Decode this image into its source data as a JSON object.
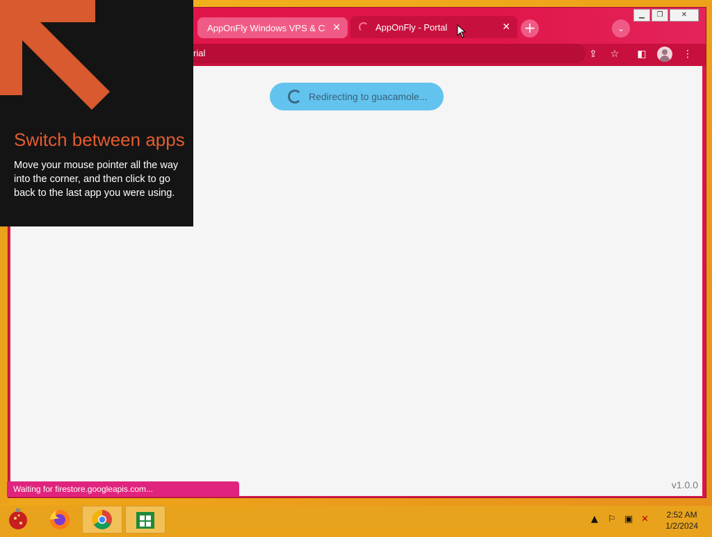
{
  "browser": {
    "tabs": [
      {
        "label": "AppOnFly Windows VPS & Cloud"
      },
      {
        "label": "AppOnFly - Portal"
      }
    ],
    "address_text": "rial"
  },
  "page": {
    "redirect_text": "Redirecting to guacamole...",
    "version": "v1.0.0",
    "status_text": "Waiting for firestore.googleapis.com..."
  },
  "tip": {
    "title": "Switch between apps",
    "body": "Move your mouse pointer all the way into the corner, and then click to go back to the last app you were using."
  },
  "taskbar": {
    "apps": [
      "ornament-icon",
      "firefox-icon",
      "chrome-icon",
      "store-icon"
    ],
    "clock_time": "2:52 AM",
    "clock_date": "1/2/2024"
  },
  "colors": {
    "browser_theme": "#d8194a",
    "tip_accent": "#e35c2f",
    "pill": "#62c3ee",
    "status_bar": "#e0247d"
  }
}
